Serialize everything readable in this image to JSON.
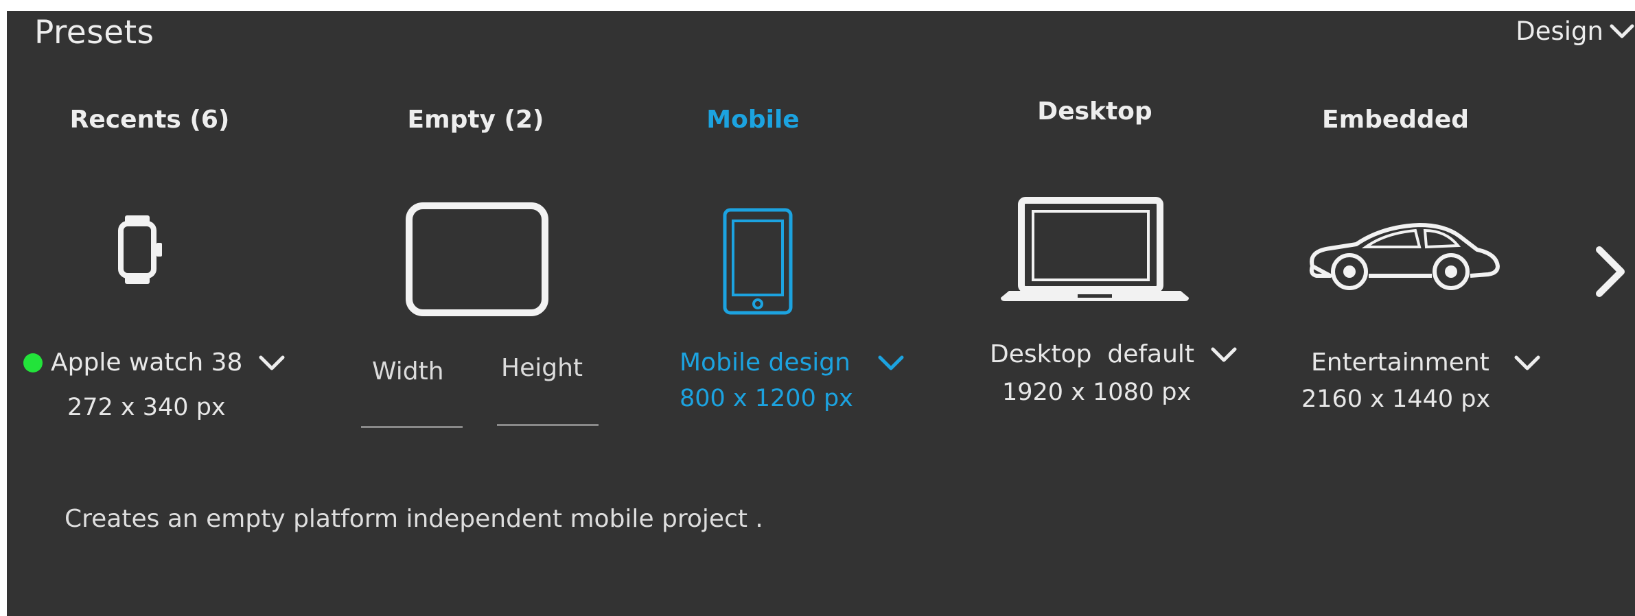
{
  "panel": {
    "title": "Presets",
    "menu_label": "Design"
  },
  "categories": [
    {
      "heading": "Recents (6)",
      "icon": "smartwatch-icon",
      "preset_name": "Apple watch 38",
      "preset_size": "272 x 340 px",
      "status_dot_color": "#22e33a"
    },
    {
      "heading": "Empty (2)",
      "icon": "blank-screen-icon",
      "width_label": "Width",
      "height_label": "Height"
    },
    {
      "heading": "Mobile",
      "icon": "tablet-icon",
      "preset_name": "Mobile design",
      "preset_size": "800 x 1200 px",
      "selected": true
    },
    {
      "heading": "Desktop",
      "icon": "laptop-icon",
      "preset_name": "Desktop  default",
      "preset_size": "1920 x 1080 px"
    },
    {
      "heading": "Embedded",
      "icon": "car-icon",
      "preset_name": "Entertainment",
      "preset_size": "2160 x 1440 px"
    }
  ],
  "description": "Creates an empty platform independent mobile  project .",
  "colors": {
    "background": "#333333",
    "accent": "#1ca3e0",
    "text": "#e8e8e8",
    "status_green": "#22e33a"
  }
}
